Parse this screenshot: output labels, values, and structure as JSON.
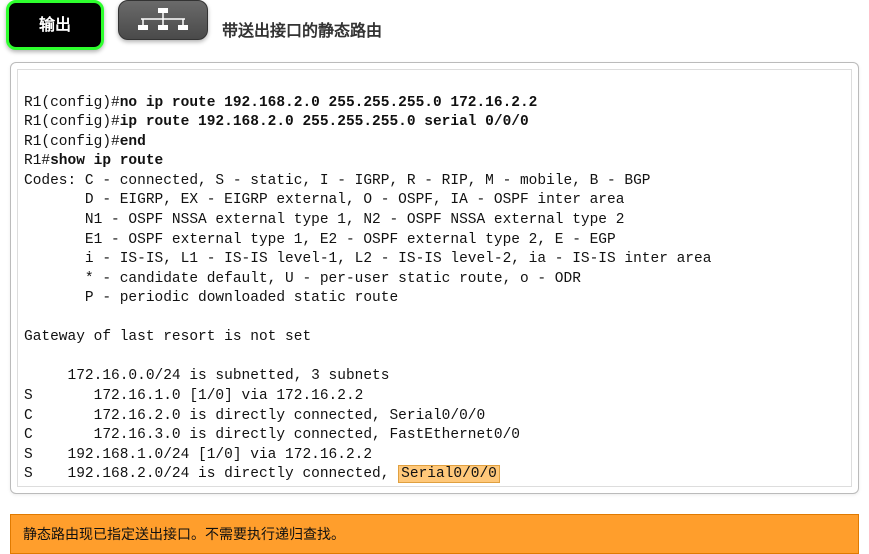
{
  "header": {
    "output_btn": "输出",
    "title": "带送出接口的静态路由"
  },
  "terminal": {
    "prompt_config": "R1(config)#",
    "prompt_exec": "R1#",
    "cmd1": "no ip route 192.168.2.0 255.255.255.0 172.16.2.2",
    "cmd2": "ip route 192.168.2.0 255.255.255.0 serial 0/0/0",
    "cmd3": "end",
    "cmd4": "show ip route",
    "codes0": "Codes: C - connected, S - static, I - IGRP, R - RIP, M - mobile, B - BGP",
    "codes1": "       D - EIGRP, EX - EIGRP external, O - OSPF, IA - OSPF inter area",
    "codes2": "       N1 - OSPF NSSA external type 1, N2 - OSPF NSSA external type 2",
    "codes3": "       E1 - OSPF external type 1, E2 - OSPF external type 2, E - EGP",
    "codes4": "       i - IS-IS, L1 - IS-IS level-1, L2 - IS-IS level-2, ia - IS-IS inter area",
    "codes5": "       * - candidate default, U - per-user static route, o - ODR",
    "codes6": "       P - periodic downloaded static route",
    "gateway": "Gateway of last resort is not set",
    "route0": "     172.16.0.0/24 is subnetted, 3 subnets",
    "route1": "S       172.16.1.0 [1/0] via 172.16.2.2",
    "route2": "C       172.16.2.0 is directly connected, Serial0/0/0",
    "route3": "C       172.16.3.0 is directly connected, FastEthernet0/0",
    "route4": "S    192.168.1.0/24 [1/0] via 172.16.2.2",
    "route5_pre": "S    192.168.2.0/24 is directly connected, ",
    "route5_hl": "Serial0/0/0"
  },
  "footer": {
    "text": "静态路由现已指定送出接口。不需要执行递归查找。"
  }
}
